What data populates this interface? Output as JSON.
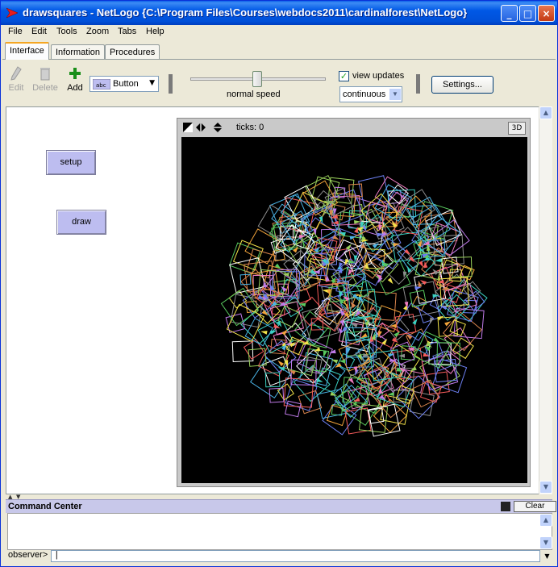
{
  "window": {
    "title": "drawsquares - NetLogo {C:\\Program Files\\Courses\\webdocs2011\\cardinalforest\\NetLogo}",
    "controls": {
      "minimize": "_",
      "maximize": "□",
      "close": "×"
    }
  },
  "menu": [
    "File",
    "Edit",
    "Tools",
    "Zoom",
    "Tabs",
    "Help"
  ],
  "tabs": [
    {
      "label": "Interface",
      "active": true
    },
    {
      "label": "Information",
      "active": false
    },
    {
      "label": "Procedures",
      "active": false
    }
  ],
  "toolbar": {
    "edit_label": "Edit",
    "delete_label": "Delete",
    "add_label": "Add",
    "widget_type": "Button",
    "speed_label": "normal speed",
    "speed_value": 0.5,
    "view_updates_label": "view updates",
    "view_updates_checked": true,
    "update_mode": "continuous",
    "settings_label": "Settings..."
  },
  "interface": {
    "buttons": [
      {
        "label": "setup"
      },
      {
        "label": "draw"
      }
    ]
  },
  "view": {
    "ticks_label": "ticks: 0",
    "btn_3d": "3D",
    "world_background": "#000000"
  },
  "command_center": {
    "title": "Command Center",
    "clear_label": "Clear",
    "prompt": "observer>",
    "input_value": "|"
  },
  "colors": {
    "titlebar": "#0054e3",
    "button_face": "#bdbdf0",
    "command_center_header": "#c8c8ea"
  }
}
